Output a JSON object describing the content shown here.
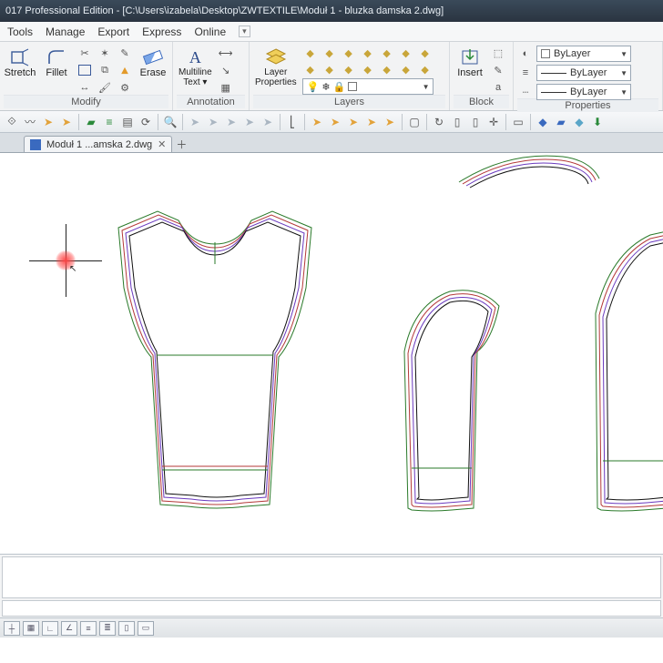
{
  "title": "017 Professional Edition - [C:\\Users\\izabela\\Desktop\\ZWTEXTILE\\Moduł 1 - bluzka damska 2.dwg]",
  "menu": {
    "tools": "Tools",
    "manage": "Manage",
    "export": "Export",
    "express": "Express",
    "online": "Online"
  },
  "ribbon": {
    "modify": {
      "stretch": "Stretch",
      "fillet": "Fillet",
      "erase": "Erase",
      "label": "Modify"
    },
    "annotation": {
      "mtext": "Multiline\nText ▾",
      "label": "Annotation"
    },
    "layers": {
      "props": "Layer\nProperties",
      "label": "Layers"
    },
    "block": {
      "insert": "Insert",
      "label": "Block"
    },
    "properties": {
      "bylayer": "ByLayer",
      "label": "Properties"
    }
  },
  "tab": {
    "name": "Moduł 1 ...amska 2.dwg"
  }
}
